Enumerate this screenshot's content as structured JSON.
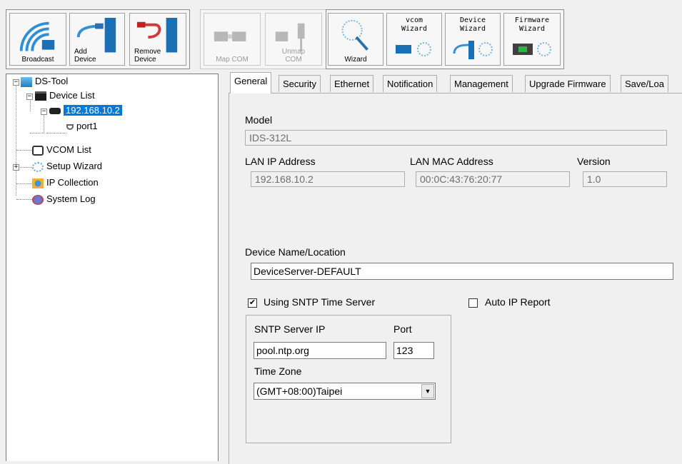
{
  "toolbar": {
    "broadcast_label": "Broadcast",
    "add_device_label": "Add\nDevice",
    "remove_device_label": "Remove\nDevice",
    "map_com_label": "Map COM",
    "unmap_com_label": "Unmap\nCOM",
    "wizard_label": "Wizard",
    "vcom_wizard_label": "vcom\nWizard",
    "device_wizard_label": "Device\nWizard",
    "firmware_wizard_label": "Firmware\nWizard"
  },
  "tree": {
    "root": "DS-Tool",
    "device_list": "Device List",
    "device_ip": "192.168.10.2",
    "port": "port1",
    "vcom_list": "VCOM List",
    "setup_wizard": "Setup Wizard",
    "ip_collection": "IP Collection",
    "system_log": "System Log"
  },
  "tabs": [
    "General",
    "Security",
    "Ethernet",
    "Notification",
    "Management",
    "Upgrade Firmware",
    "Save/Loa"
  ],
  "general": {
    "model_label": "Model",
    "model_value": "IDS-312L",
    "lan_ip_label": "LAN IP Address",
    "lan_ip_value": "192.168.10.2",
    "lan_mac_label": "LAN MAC Address",
    "lan_mac_value": "00:0C:43:76:20:77",
    "version_label": "Version",
    "version_value": "1.0",
    "device_name_label": "Device Name/Location",
    "device_name_value": "DeviceServer-DEFAULT",
    "sntp_checkbox_label": "Using SNTP Time Server",
    "sntp_checked": true,
    "auto_ip_label": "Auto IP Report",
    "auto_ip_checked": false,
    "sntp_server_label": "SNTP Server IP",
    "sntp_server_value": "pool.ntp.org",
    "port_label": "Port",
    "port_value": "123",
    "timezone_label": "Time Zone",
    "timezone_value": "(GMT+08:00)Taipei"
  },
  "colors": {
    "selection": "#0078d7",
    "panel_bg": "#f0f0f0"
  }
}
